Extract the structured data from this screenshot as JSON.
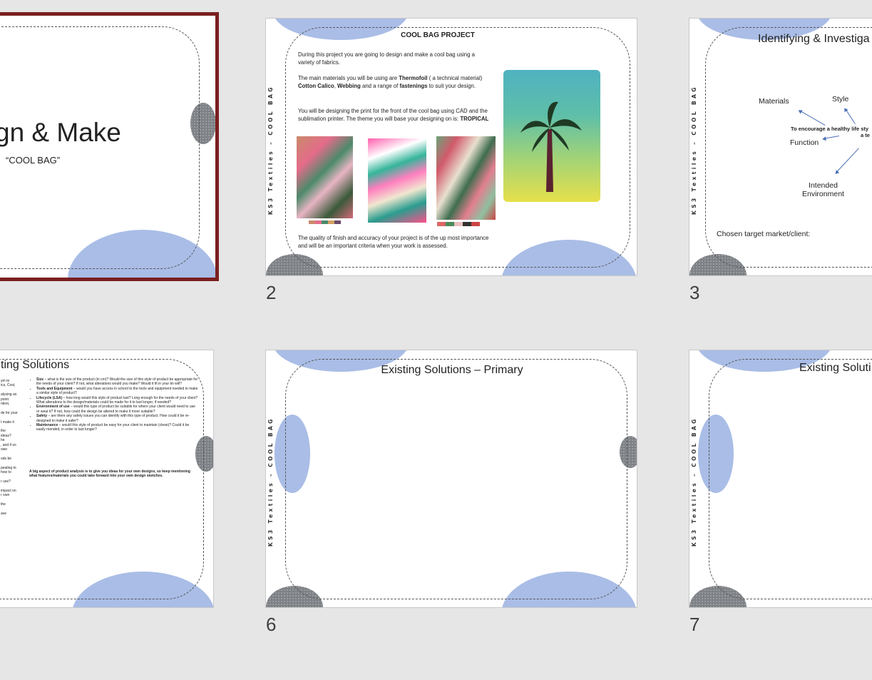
{
  "colors": {
    "selected_border": "#7a1f1f",
    "accent_blue": "#a9bde6"
  },
  "slide1": {
    "title": "gn & Make",
    "subtitle": "“COOL BAG”"
  },
  "slide2": {
    "number": "2",
    "side_label": "KS3 Textiles – COOL BAG",
    "heading": "COOL BAG PROJECT",
    "p1": "During this project you are going to design and make a cool bag using a variety of fabrics.",
    "p2_a": "The main materials you will be using are ",
    "p2_b": "Thermofoil",
    "p2_c": " ( a technical material) ",
    "p2_d": "Cotton Calico",
    "p2_e": ", ",
    "p2_f": "Webbing",
    "p2_g": " and a range of ",
    "p2_h": "fastenings",
    "p2_i": " to suit your design.",
    "p3_a": "You will be designing the print for the front of the cool bag using CAD and the sublimation printer. The theme you will base your designing on is: ",
    "p3_b": "TROPICAL",
    "p4": "The quality of finish and accuracy of your project is of the up most importance and will be an important criteria when your work is assessed."
  },
  "slide3": {
    "number": "3",
    "side_label": "KS3 Textiles – COOL BAG",
    "title": "Identifying & Investiga",
    "materials": "Materials",
    "style": "Style",
    "center_line1": "To encourage a healthy life sty",
    "center_line2": "a te",
    "function": "Function",
    "intended_line1": "Intended",
    "intended_line2": "Environment",
    "target": "Chosen target market/client:"
  },
  "slide5": {
    "title": "ting Solutions",
    "bullets": [
      {
        "head": "Size",
        "text": " – what is the size of the product (in cm)? Would the size of this style of product be appropriate for the needs of your client? If not, what alterations would you make? Would it fit in your tin will?"
      },
      {
        "head": "Tools and Equipment",
        "text": " – would you have access in school to the tools and equipment needed to make a similar style of product?"
      },
      {
        "head": "Lifecycle (LSA)",
        "text": " – how long would this style of product last? Long enough for the needs of your client? What alterations to the design/materials could be made for it to last longer, if needed?"
      },
      {
        "head": "Environment of use",
        "text": " – would this type of product be suitable for where your client would need to use or wear it? If not, how could the design be altered to make it more suitable?"
      },
      {
        "head": "Safety",
        "text": " – are there any safety issues you can identify with this type of product. How could it be re-designed to make it safer?"
      },
      {
        "head": "Maintenance",
        "text": " – would this style of product be easy for your client to maintain (clean)? Could it be easily mended, in order to last longer?"
      }
    ],
    "summary": "A big aspect of product analysis is to give you ideas for your own designs, so keep mentioning what features/materials you could take forward into your own design sketches.",
    "left_fragments": [
      "ym to",
      "ics, Cost,",
      "",
      "alysing an",
      "point.",
      "ntext,",
      "",
      "de for your",
      "",
      "t make it",
      "",
      "the",
      "ideas?",
      "he",
      ", and if so",
      "own",
      "",
      "ods be",
      "",
      "pealing to",
      "how to",
      "",
      "r use?",
      "",
      "impact on",
      "r own",
      "",
      "the",
      "",
      "ave"
    ]
  },
  "slide6": {
    "number": "6",
    "side_label": "KS3 Textiles – COOL BAG",
    "title": "Existing Solutions – Primary"
  },
  "slide7": {
    "number": "7",
    "side_label": "KS3 Textiles – COOL BAG",
    "title": "Existing Soluti"
  }
}
